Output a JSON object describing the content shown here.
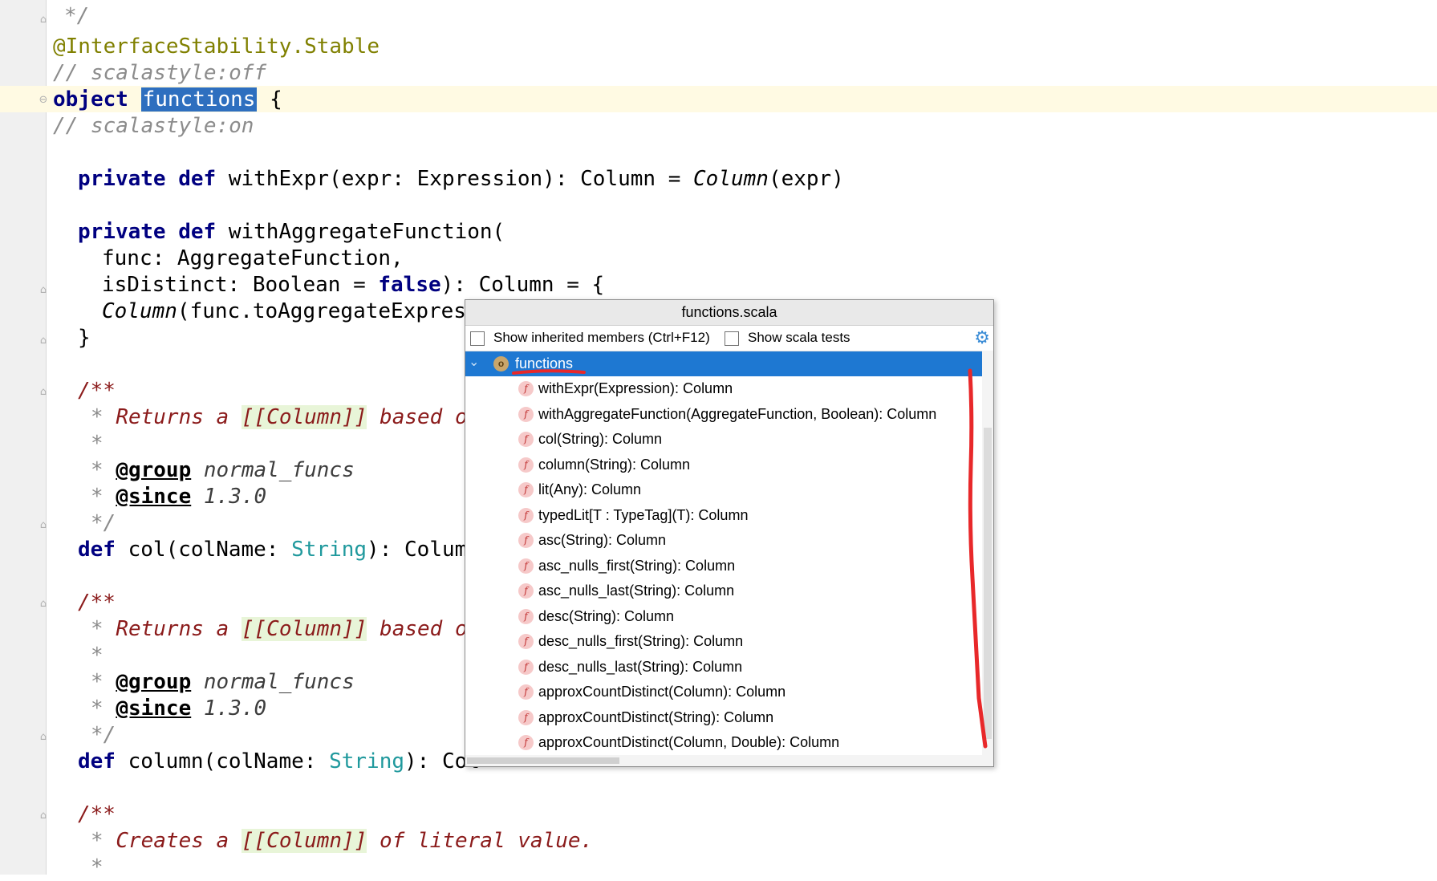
{
  "editor": {
    "lines": {
      "l0": "*/",
      "l1": "@InterfaceStability.Stable",
      "l2": "// scalastyle:off",
      "l3_kw": "object",
      "l3_name": "functions",
      "l3_rest": " {",
      "l4": "// scalastyle:on",
      "l5_kw": "private def",
      "l5_rest": " withExpr(expr: Expression): Column = ",
      "l5_it": "Column",
      "l5_end": "(expr)",
      "l6_kw": "private def",
      "l6_rest": " withAggregateFunction(",
      "l7": "func: AggregateFunction,",
      "l8_a": "isDistinct: Boolean = ",
      "l8_kw": "false",
      "l8_b": "): Column = {",
      "l9_it": "Column",
      "l9_rest": "(func.toAggregateExpress",
      "l10": "}",
      "d1_open": "/**",
      "d1_star": "* ",
      "d1_text1": "Returns a ",
      "d1_link": "[[Column]]",
      "d1_text2": " based on",
      "d1_blank": "*",
      "d1_group_tag": "@group",
      "d1_group_val": " normal_funcs",
      "d1_since_tag": "@since",
      "d1_since_val": " 1.3.0",
      "d1_close": "*/",
      "def1_kw": "def",
      "def1_a": " col(colName: ",
      "def1_type": "String",
      "def1_b": "): Column",
      "d2_open": "/**",
      "d2_text1": "Returns a ",
      "d2_link": "[[Column]]",
      "d2_text2": " based on",
      "d2_group_tag": "@group",
      "d2_group_val": " normal_funcs",
      "d2_since_tag": "@since",
      "d2_since_val": " 1.3.0",
      "d2_close": "*/",
      "def2_kw": "def",
      "def2_a": " column(colName: ",
      "def2_type": "String",
      "def2_b": "): Col",
      "d3_open": "/**",
      "d3_text1": "Creates a ",
      "d3_link": "[[Column]]",
      "d3_text2": " of literal value.",
      "d3_blank": "*"
    }
  },
  "popup": {
    "title": "functions.scala",
    "show_inherited_label": "Show inherited members (Ctrl+F12)",
    "show_inherited_checked": false,
    "show_scala_tests_label": "Show scala tests",
    "show_scala_tests_checked": false,
    "settings_icon": "gear-icon",
    "root": {
      "label": "functions",
      "icon": "object-icon",
      "icon_glyph": "o",
      "expanded": true
    },
    "member_icon_glyph": "f",
    "members": [
      "withExpr(Expression): Column",
      "withAggregateFunction(AggregateFunction, Boolean): Column",
      "col(String): Column",
      "column(String): Column",
      "lit(Any): Column",
      "typedLit[T : TypeTag](T): Column",
      "asc(String): Column",
      "asc_nulls_first(String): Column",
      "asc_nulls_last(String): Column",
      "desc(String): Column",
      "desc_nulls_first(String): Column",
      "desc_nulls_last(String): Column",
      "approxCountDistinct(Column): Column",
      "approxCountDistinct(String): Column",
      "approxCountDistinct(Column, Double): Column"
    ]
  },
  "colors": {
    "selection": "#1e78d2",
    "annotation_red": "#e8282a",
    "keyword": "#000080",
    "current_line": "#fffae3"
  }
}
